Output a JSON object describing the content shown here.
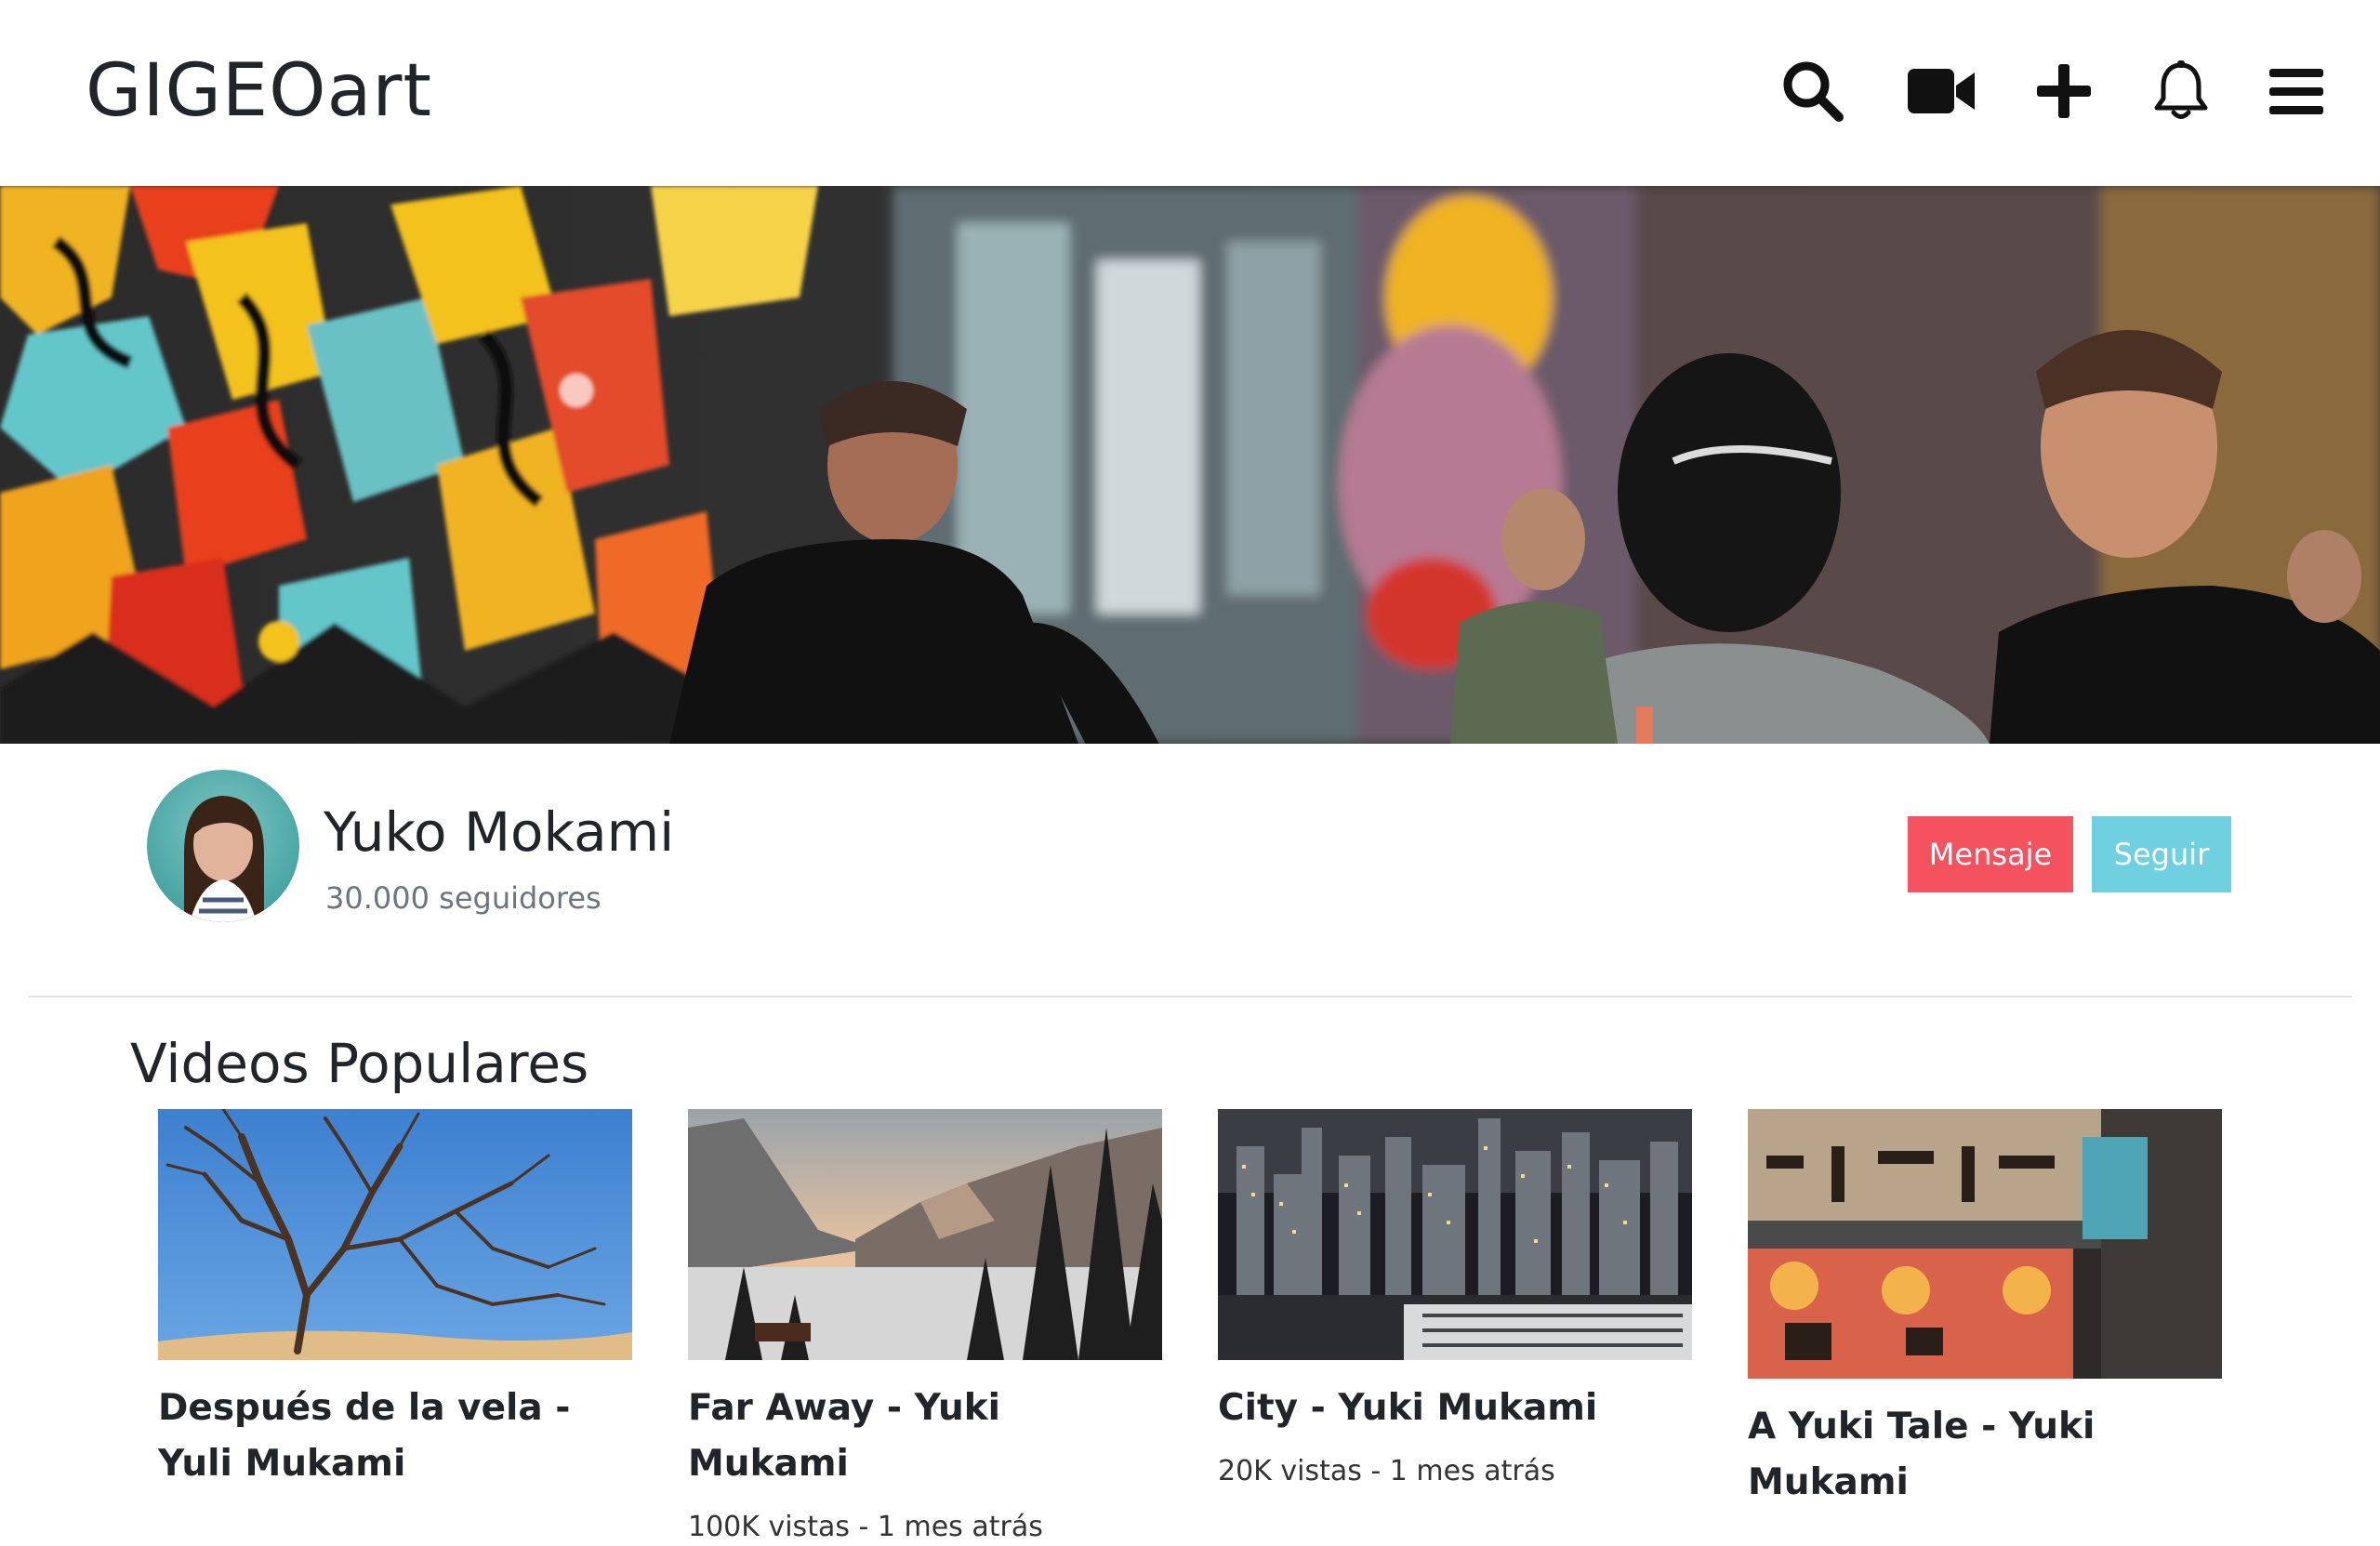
{
  "app": {
    "brand": "GIGEOart"
  },
  "navbar": {
    "icons": [
      "search-icon",
      "video-camera-icon",
      "plus-icon",
      "bell-icon",
      "hamburger-menu-icon"
    ]
  },
  "profile": {
    "name": "Yuko Mokami",
    "followers": "30.000 seguidores",
    "message_label": "Mensaje",
    "follow_label": "Seguir"
  },
  "colors": {
    "message_button": "#f5525f",
    "follow_button": "#6fd0e0"
  },
  "videos": {
    "section_title": "Videos Populares",
    "items": [
      {
        "title": "Después de la vela - Yuli Mukami",
        "meta": ""
      },
      {
        "title": "Far Away - Yuki Mukami",
        "meta": "100K vistas - 1 mes atrás"
      },
      {
        "title": "City - Yuki Mukami",
        "meta": "20K vistas - 1 mes atrás"
      },
      {
        "title": "A Yuki Tale - Yuki Mukami",
        "meta": ""
      }
    ]
  }
}
